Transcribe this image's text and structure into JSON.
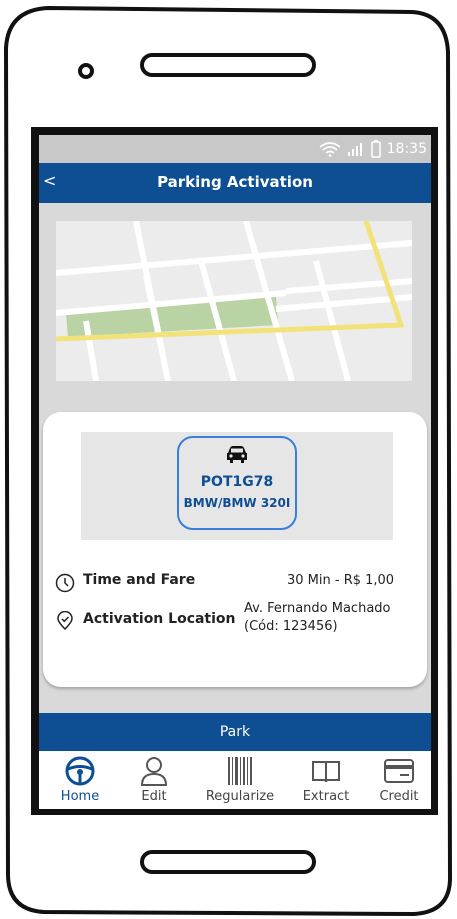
{
  "status_bar": {
    "time": "18:35"
  },
  "header": {
    "back_label": "<",
    "title": "Parking Activation"
  },
  "vehicle": {
    "plate": "POT1G78",
    "model": "BMW/BMW 320I"
  },
  "details": {
    "time_fare_label": "Time and Fare",
    "time_fare_value": "30 Min - R$ 1,00",
    "location_label": "Activation Location",
    "location_line1": "Av. Fernando Machado",
    "location_line2": "(Cód: 123456)"
  },
  "actions": {
    "park_label": "Park"
  },
  "nav": {
    "items": [
      {
        "label": "Home",
        "icon": "steering-wheel-icon",
        "active": true
      },
      {
        "label": "Edit",
        "icon": "user-icon",
        "active": false
      },
      {
        "label": "Regularize",
        "icon": "barcode-icon",
        "active": false
      },
      {
        "label": "Extract",
        "icon": "book-icon",
        "active": false
      },
      {
        "label": "Credit",
        "icon": "credit-card-icon",
        "active": false
      }
    ]
  },
  "colors": {
    "primary": "#0e4f93",
    "accent_border": "#3b7ddd",
    "map_green": "#b9d3a5",
    "map_road": "#f2e27a"
  }
}
